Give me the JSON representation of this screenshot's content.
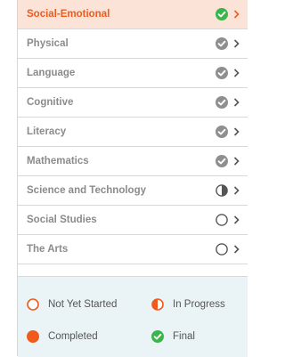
{
  "domains": [
    {
      "label": "Social-Emotional",
      "status": "final",
      "active": true
    },
    {
      "label": "Physical",
      "status": "completed-gray",
      "active": false
    },
    {
      "label": "Language",
      "status": "completed-gray",
      "active": false
    },
    {
      "label": "Cognitive",
      "status": "completed-gray",
      "active": false
    },
    {
      "label": "Literacy",
      "status": "completed-gray",
      "active": false
    },
    {
      "label": "Mathematics",
      "status": "completed-gray",
      "active": false
    },
    {
      "label": "Science and Technology",
      "status": "in-progress-gray",
      "active": false
    },
    {
      "label": "Social Studies",
      "status": "not-started-gray",
      "active": false
    },
    {
      "label": "The Arts",
      "status": "not-started-gray",
      "active": false
    }
  ],
  "legend": {
    "not_started": "Not Yet Started",
    "in_progress": "In Progress",
    "completed": "Completed",
    "final": "Final"
  },
  "colors": {
    "accent": "#f05a1a",
    "final_green": "#3ab54a",
    "gray_icon": "#8f8f8f",
    "active_bg": "#fbe3d8",
    "legend_bg": "#eaf3f5"
  }
}
